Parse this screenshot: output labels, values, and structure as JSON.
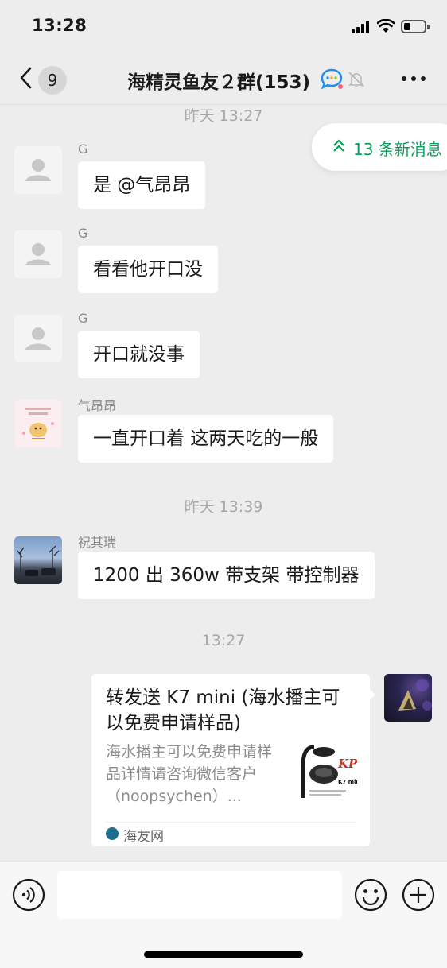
{
  "status_bar": {
    "time": "13:28",
    "battery_level": 0.35
  },
  "header": {
    "unread_count": "9",
    "title": "海精灵鱼友２群(153)",
    "icons": [
      "back-arrow-icon",
      "chat-bubble-icon",
      "mute-bell-icon",
      "more-icon"
    ]
  },
  "new_messages_pill": {
    "text": "13 条新消息",
    "color": "#07a05a"
  },
  "timestamps": [
    "昨天 13:27",
    "昨天 13:39",
    "13:27"
  ],
  "messages": [
    {
      "sender": "G",
      "text": "是 @气昂昂"
    },
    {
      "sender": "G",
      "text": "看看他开口没"
    },
    {
      "sender": "G",
      "text": "开口就没事"
    },
    {
      "sender": "气昂昂",
      "text": "一直开口着 这两天吃的一般"
    },
    {
      "sender": "祝其瑞",
      "text": "1200 出 360w 带支架 带控制器"
    }
  ],
  "shared_card": {
    "title": "转发送 K7 mini (海水播主可以免费申请样品)",
    "description": "海水播主可以免费申请样品详情请咨询微信客户（noopsychen）...",
    "source": "海友网",
    "thumb_brand": "KP",
    "thumb_model": "K7 mini"
  },
  "input_bar": {
    "placeholder": "",
    "icons": [
      "voice-icon",
      "emoji-icon",
      "plus-icon"
    ]
  }
}
